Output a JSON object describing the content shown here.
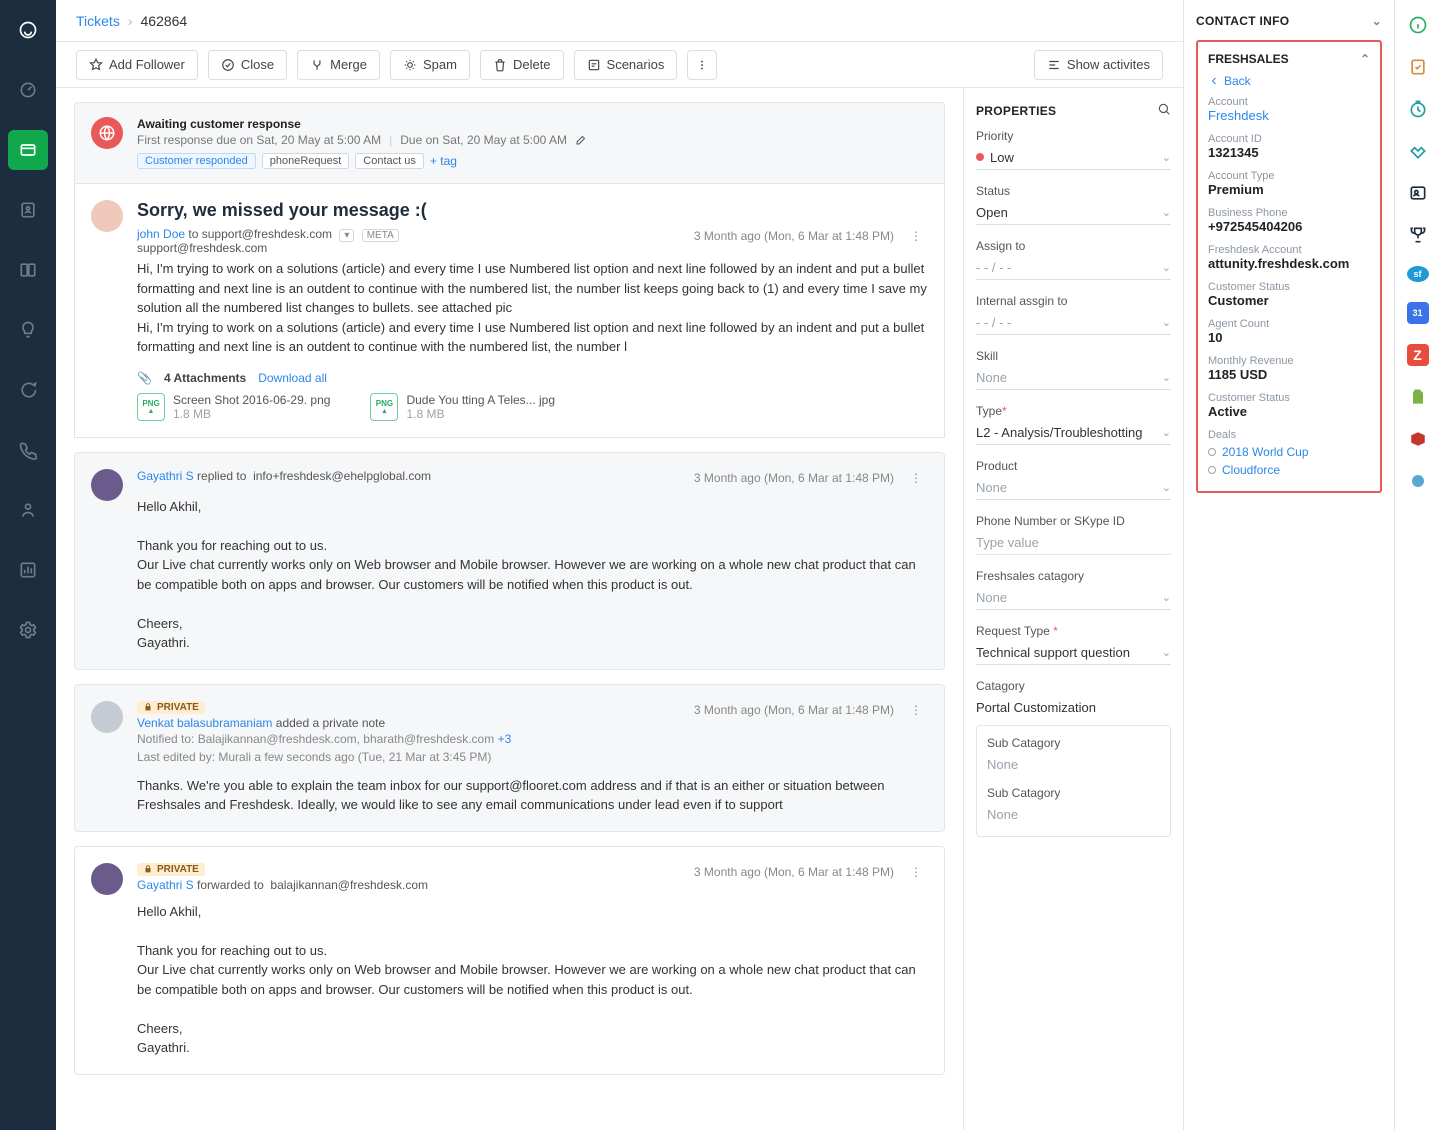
{
  "breadcrumb": {
    "root": "Tickets",
    "id": "462864"
  },
  "toolbar": {
    "add_follower": "Add Follower",
    "close": "Close",
    "merge": "Merge",
    "spam": "Spam",
    "delete": "Delete",
    "scenarios": "Scenarios",
    "show_activities": "Show activites"
  },
  "banner": {
    "status": "Awaiting customer response",
    "first_response": "First response due on Sat, 20 May at 5:00 AM",
    "due": "Due on Sat, 20 May at 5:00 AM",
    "tags": [
      "Customer responded",
      "phoneRequest",
      "Contact us"
    ],
    "add_tag": "+ tag"
  },
  "post1": {
    "subject": "Sorry, we missed your message :(",
    "from_name": "john Doe",
    "to_prefix": "to",
    "to": "support@freshdesk.com",
    "meta_chip": "META",
    "from_email": "support@freshdesk.com",
    "time": "3 Month ago (Mon, 6 Mar at 1:48 PM)",
    "body1": "Hi, I'm trying to work on a solutions (article) and every time I use Numbered list option and next line followed by an indent and put a bullet formatting and next line is an outdent to continue with the numbered list, the number list keeps going back to (1) and every time I save my solution all the numbered list changes to bullets. see attached pic",
    "body2": "Hi, I'm trying to work on a solutions (article) and every time I use Numbered list option and next line followed by an indent and put a bullet formatting and next line is an outdent to continue with the numbered list, the number l",
    "attach_count": "4 Attachments",
    "download_all": "Download all",
    "att1_name": "Screen Shot 2016-06-29. png",
    "att1_size": "1.8 MB",
    "att2_name": "Dude You tting A Teles... jpg",
    "att2_size": "1.8 MB"
  },
  "post2": {
    "from_name": "Gayathri S",
    "verb": "replied to",
    "to": "info+freshdesk@ehelpglobal.com",
    "time": "3 Month ago (Mon, 6 Mar at 1:48 PM)",
    "l1": "Hello Akhil,",
    "l2": "Thank you for reaching out to us.",
    "l3": "Our Live chat currently works only on Web browser and Mobile browser. However we are working on a whole new chat product that can be compatible both on apps and browser. Our customers will be notified when this product is out.",
    "l4": "Cheers,",
    "l5": "Gayathri."
  },
  "post3": {
    "private": "PRIVATE",
    "from_name": "Venkat balasubramaniam",
    "verb": "added a private note",
    "notified": "Notified to: Balajikannan@freshdesk.com, bharath@freshdesk.com",
    "notified_more": "+3",
    "edited": "Last edited by: Murali a few seconds ago (Tue, 21 Mar at 3:45 PM)",
    "time": "3 Month ago (Mon, 6 Mar at 1:48 PM)",
    "body": "Thanks. We're you able to explain the team inbox for our support@flooret.com address and if that is an either or situation between Freshsales and Freshdesk. Ideally, we would like to see any email communications under lead even if to support"
  },
  "post4": {
    "private": "PRIVATE",
    "from_name": "Gayathri S",
    "verb": "forwarded to",
    "to": "balajikannan@freshdesk.com",
    "time": "3 Month ago (Mon, 6 Mar at 1:48 PM)",
    "l1": "Hello Akhil,",
    "l2": "Thank you for reaching out to us.",
    "l3": "Our Live chat currently works only on Web browser and Mobile browser. However we are working on a whole new chat product that can be compatible both on apps and browser. Our customers will be notified when this product is out.",
    "l4": "Cheers,",
    "l5": "Gayathri."
  },
  "props": {
    "title": "PROPERTIES",
    "priority_label": "Priority",
    "priority": "Low",
    "status_label": "Status",
    "status": "Open",
    "assign_label": "Assign to",
    "assign": "- - / - -",
    "internal_label": "Internal assgin to",
    "internal": "- - / - -",
    "skill_label": "Skill",
    "skill": "None",
    "type_label": "Type",
    "type": "L2 - Analysis/Troubleshotting",
    "product_label": "Product",
    "product": "None",
    "phone_label": "Phone Number or SKype ID",
    "phone_placeholder": "Type value",
    "fcat_label": "Freshsales catagory",
    "fcat": "None",
    "req_label": "Request Type",
    "req": "Technical support question",
    "cat_label": "Catagory",
    "cat": "Portal Customization",
    "sub1_label": "Sub Catagory",
    "sub1": "None",
    "sub2_label": "Sub Catagory",
    "sub2": "None"
  },
  "contact": {
    "title": "CONTACT INFO",
    "card_title": "FRESHSALES",
    "back": "Back",
    "account_label": "Account",
    "account": "Freshdesk",
    "account_id_label": "Account ID",
    "account_id": "1321345",
    "account_type_label": "Account Type",
    "account_type": "Premium",
    "phone_label": "Business Phone",
    "phone": "+972545404206",
    "fd_label": "Freshdesk Account",
    "fd": "attunity.freshdesk.com",
    "cust_label": "Customer Status",
    "cust": "Customer",
    "agent_label": "Agent Count",
    "agent": "10",
    "rev_label": "Monthly Revenue",
    "rev": "1185 USD",
    "cust2_label": "Customer Status",
    "cust2": "Active",
    "deals_label": "Deals",
    "deal1": "2018 World Cup",
    "deal2": "Cloudforce"
  }
}
